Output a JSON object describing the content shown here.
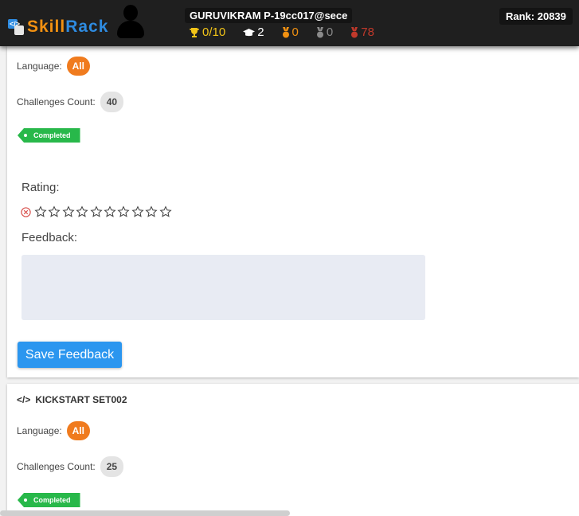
{
  "header": {
    "logo_skill": "Skill",
    "logo_rack": "Rack",
    "username": "GURUVIKRAM P-19cc017@sece",
    "stats": {
      "trophy": "0/10",
      "certificates": "2",
      "gold": "0",
      "silver": "0",
      "bronze": "78"
    },
    "rank": "Rank: 20839"
  },
  "card1": {
    "language_label": "Language:",
    "language_value": "All",
    "challenges_label": "Challenges Count:",
    "challenges_value": "40",
    "status": "Completed",
    "rating_label": "Rating:",
    "star_count": 10,
    "feedback_label": "Feedback:",
    "feedback_value": "",
    "save_label": "Save Feedback"
  },
  "card2": {
    "title": "KICKSTART SET002",
    "language_label": "Language:",
    "language_value": "All",
    "challenges_label": "Challenges Count:",
    "challenges_value": "25",
    "status": "Completed"
  },
  "icons": {
    "logo": "skillrack-logo-icon",
    "avatar": "user-avatar-icon",
    "trophy": "trophy-icon",
    "cap": "graduation-cap-icon",
    "gold": "gold-medal-icon",
    "silver": "silver-medal-icon",
    "bronze": "bronze-medal-icon",
    "cancel": "cancel-rating-icon",
    "star": "star-outline-icon",
    "code": "code-icon"
  },
  "colors": {
    "header_bg": "#1f1f1f",
    "accent_orange": "#f07b1e",
    "completed_green": "#28b84a",
    "button_blue": "#2b96ef"
  }
}
